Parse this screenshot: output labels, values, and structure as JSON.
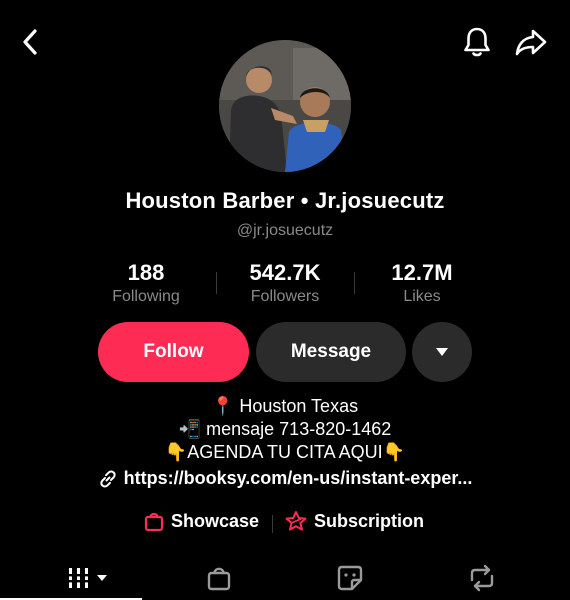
{
  "header": {
    "back_icon": "chevron-left-icon",
    "bell_icon": "bell-icon",
    "share_icon": "share-arrow-icon"
  },
  "profile": {
    "display_name": "Houston Barber • Jr.josuecutz",
    "username": "@jr.josuecutz"
  },
  "stats": [
    {
      "value": "188",
      "label": "Following"
    },
    {
      "value": "542.7K",
      "label": "Followers"
    },
    {
      "value": "12.7M",
      "label": "Likes"
    }
  ],
  "actions": {
    "follow_label": "Follow",
    "message_label": "Message",
    "more_icon": "caret-down-icon"
  },
  "bio": {
    "line1": "📍 Houston Texas",
    "line2": "📲 mensaje 713-820-1462",
    "line3": "👇AGENDA TU CITA AQUI👇",
    "link": "https://booksy.com/en-us/instant-exper..."
  },
  "profile_tabs": {
    "showcase": "Showcase",
    "subscription": "Subscription"
  },
  "colors": {
    "accent": "#fe2c55",
    "muted": "#8a8a8a",
    "button_dark": "#2b2b2b"
  }
}
